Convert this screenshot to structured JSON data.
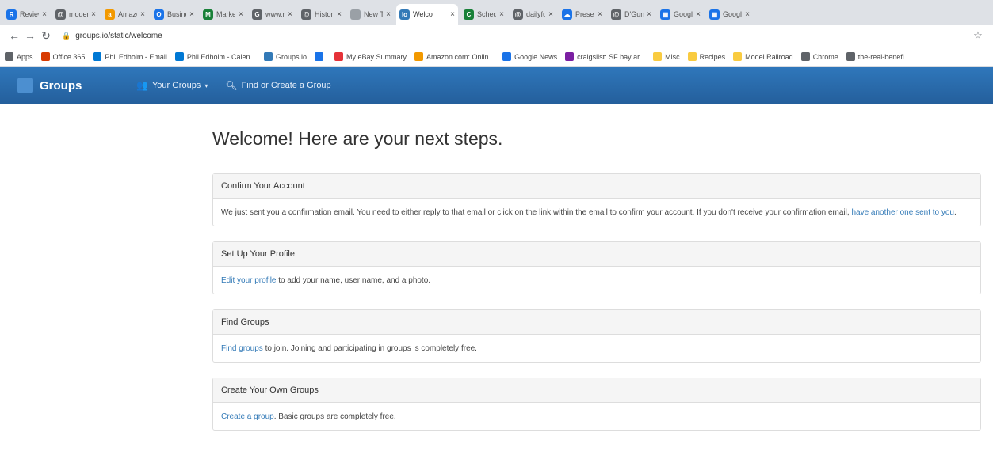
{
  "browser": {
    "tabs": [
      {
        "label": "Review",
        "color": "#1a73e8",
        "glyph": "R"
      },
      {
        "label": "moder",
        "color": "#5f6368",
        "glyph": "@"
      },
      {
        "label": "Amazo",
        "color": "#f29900",
        "glyph": "a"
      },
      {
        "label": "Busine",
        "color": "#1a73e8",
        "glyph": "O"
      },
      {
        "label": "Marke",
        "color": "#188038",
        "glyph": "M"
      },
      {
        "label": "www.r",
        "color": "#5f6368",
        "glyph": "G"
      },
      {
        "label": "Histor",
        "color": "#5f6368",
        "glyph": "@"
      },
      {
        "label": "New Tab",
        "color": "#9aa0a6",
        "glyph": ""
      },
      {
        "label": "Welco",
        "color": "#337ab7",
        "glyph": "io",
        "active": true
      },
      {
        "label": "Sched",
        "color": "#188038",
        "glyph": "C"
      },
      {
        "label": "dailyfu",
        "color": "#5f6368",
        "glyph": "@"
      },
      {
        "label": "Prese",
        "color": "#1a73e8",
        "glyph": "☁"
      },
      {
        "label": "D'Gun",
        "color": "#5f6368",
        "glyph": "@"
      },
      {
        "label": "Google",
        "color": "#1a73e8",
        "glyph": "▦"
      },
      {
        "label": "Google",
        "color": "#1a73e8",
        "glyph": "▦"
      }
    ],
    "url": "groups.io/static/welcome",
    "bookmarks": [
      {
        "label": "Apps",
        "color": "#5f6368"
      },
      {
        "label": "Office 365",
        "color": "#d83b01"
      },
      {
        "label": "Phil Edholm - Email",
        "color": "#0078d4"
      },
      {
        "label": "Phil Edholm - Calen...",
        "color": "#0078d4"
      },
      {
        "label": "Groups.io",
        "color": "#337ab7"
      },
      {
        "label": "",
        "color": "#1a73e8"
      },
      {
        "label": "My eBay Summary",
        "color": "#e53238"
      },
      {
        "label": "Amazon.com: Onlin...",
        "color": "#f29900"
      },
      {
        "label": "Google News",
        "color": "#1a73e8"
      },
      {
        "label": "craigslist: SF bay ar...",
        "color": "#7b1fa2"
      },
      {
        "label": "Misc",
        "color": "#f9cb40"
      },
      {
        "label": "Recipes",
        "color": "#f9cb40"
      },
      {
        "label": "Model Railroad",
        "color": "#f9cb40"
      },
      {
        "label": "Chrome",
        "color": "#5f6368"
      },
      {
        "label": "the-real-benefi",
        "color": "#5f6368"
      }
    ]
  },
  "navbar": {
    "brand": "Groups",
    "your_groups": "Your Groups",
    "find_create": "Find or Create a Group",
    "bg": "#2a6fb0"
  },
  "main": {
    "title": "Welcome! Here are your next steps.",
    "panels": {
      "confirm": {
        "heading": "Confirm Your Account",
        "text": "We just sent you a confirmation email. You need to either reply to that email or click on the link within the email to confirm your account. If you don't receive your confirmation email,",
        "link": "have another one sent to you",
        "after": "."
      },
      "profile": {
        "heading": "Set Up Your Profile",
        "link": "Edit your profile",
        "text": " to add your name, user name, and a photo."
      },
      "find": {
        "heading": "Find Groups",
        "link": "Find groups",
        "text": " to join. Joining and participating in groups is completely free."
      },
      "create": {
        "heading": "Create Your Own Groups",
        "link": "Create a group",
        "text": ". Basic groups are completely free."
      }
    },
    "link_color": "#337ab7"
  }
}
